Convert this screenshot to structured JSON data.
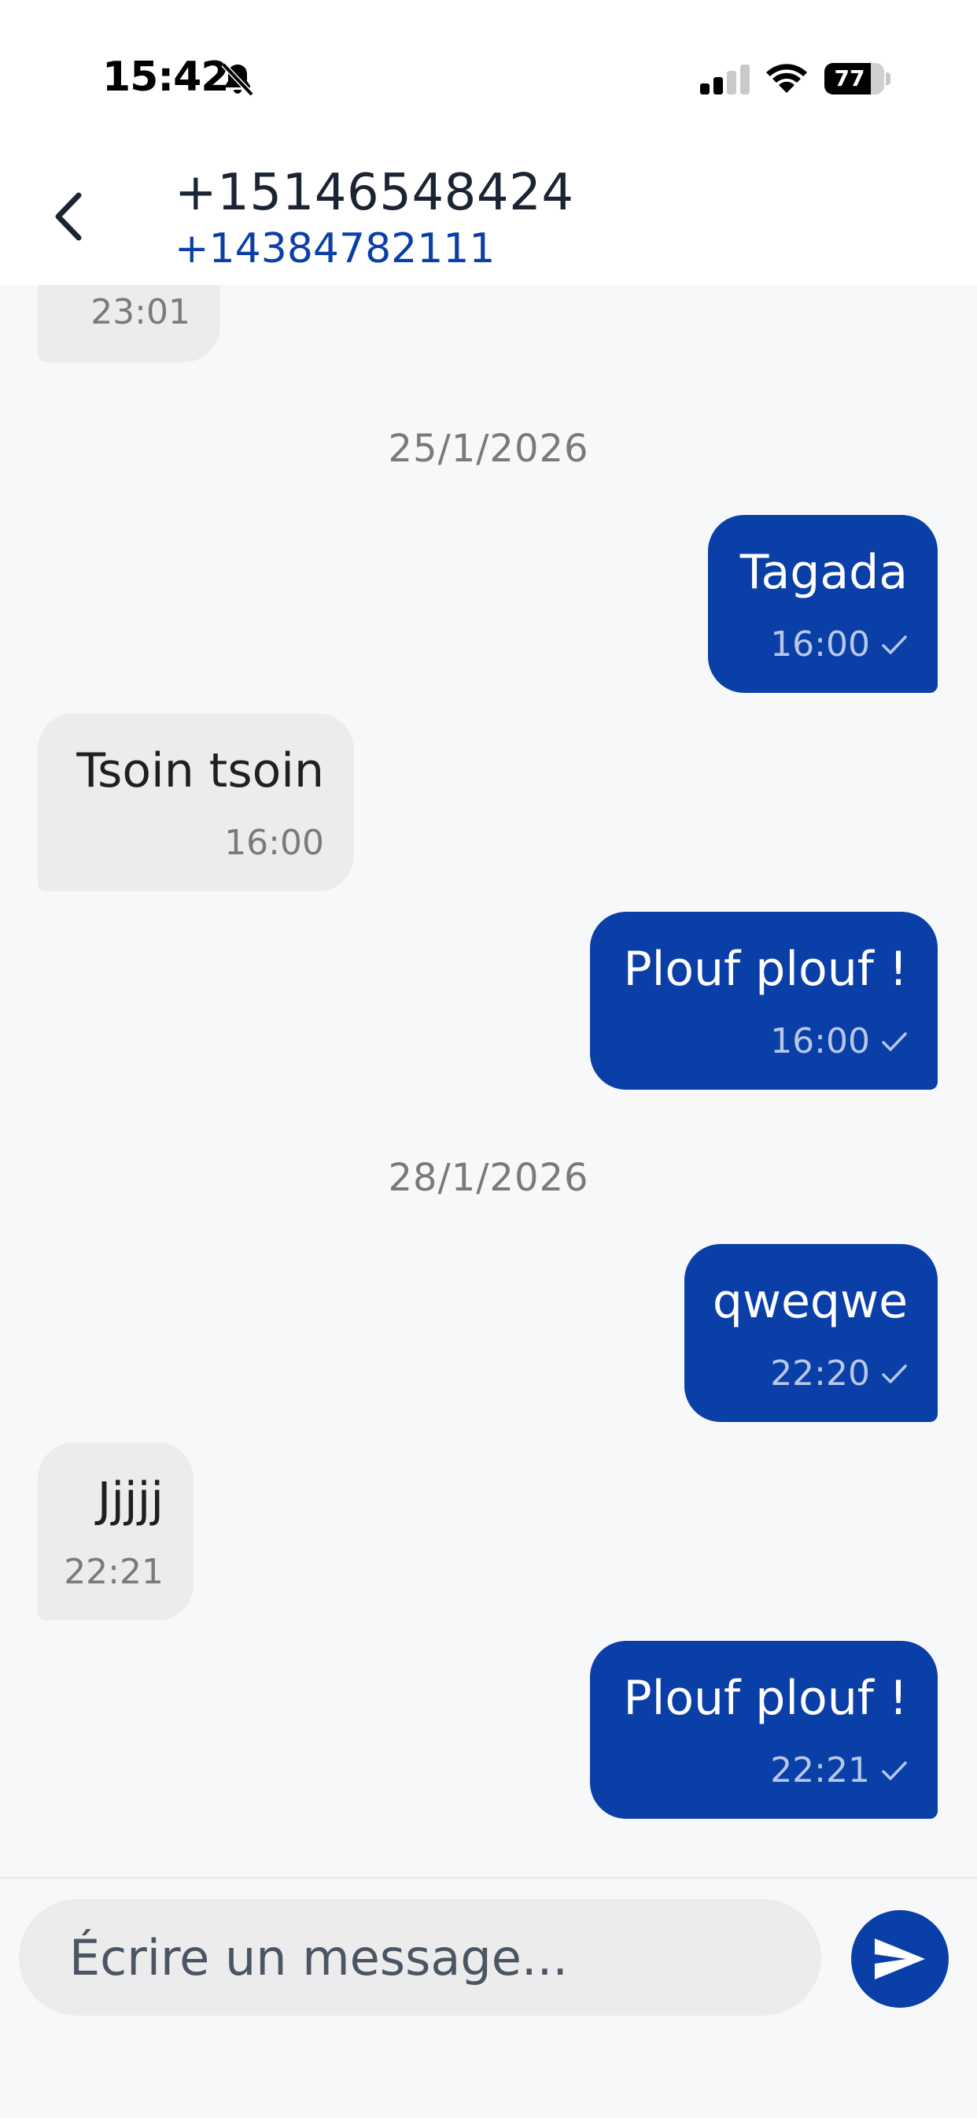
{
  "status_bar": {
    "time": "15:42",
    "battery": "77",
    "battery_level": 0.77,
    "icons": [
      "bell-slash-icon",
      "cellular-signal-icon",
      "wifi-icon",
      "battery-icon"
    ]
  },
  "header": {
    "contact_number": "+15146548424",
    "own_number": "+14384782111",
    "back_icon": "chevron-left-icon"
  },
  "messages": [
    {
      "direction": "in",
      "text": "",
      "time": "23:01"
    },
    {
      "type": "date",
      "label": "25/1/2026"
    },
    {
      "direction": "out",
      "text": "Tagada",
      "time": "16:00",
      "status_icon": "check-icon"
    },
    {
      "direction": "in",
      "text": "Tsoin tsoin",
      "time": "16:00"
    },
    {
      "direction": "out",
      "text": "Plouf plouf !",
      "time": "16:00",
      "status_icon": "check-icon"
    },
    {
      "type": "date",
      "label": "28/1/2026"
    },
    {
      "direction": "out",
      "text": "qweqwe",
      "time": "22:20",
      "status_icon": "check-icon"
    },
    {
      "direction": "in",
      "text": "Jjjjj",
      "time": "22:21"
    },
    {
      "direction": "out",
      "text": "Plouf plouf !",
      "time": "22:21",
      "status_icon": "check-icon"
    }
  ],
  "composer": {
    "placeholder": "Écrire un message...",
    "send_icon": "send-icon"
  },
  "colors": {
    "accent": "#0a3fa8",
    "incoming_bubble": "#ececec",
    "background": "#f7f8fa"
  }
}
